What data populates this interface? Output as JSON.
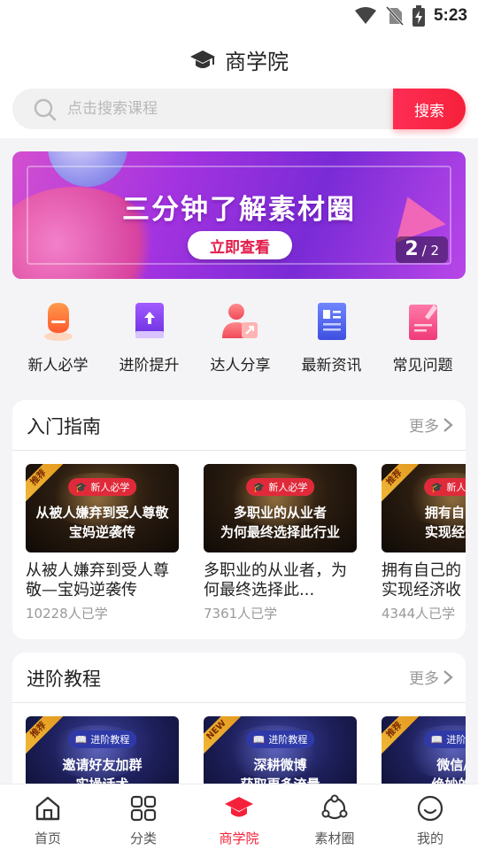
{
  "status_bar": {
    "time": "5:23"
  },
  "header": {
    "title": "商学院"
  },
  "search": {
    "placeholder": "点击搜索课程",
    "button_label": "搜索"
  },
  "banner": {
    "headline": "三分钟了解素材圈",
    "cta_label": "立即查看",
    "page_current": "2",
    "page_total": "/ 2"
  },
  "quick_links": [
    {
      "label": "新人必学",
      "icon": "newbie-icon"
    },
    {
      "label": "进阶提升",
      "icon": "upgrade-book-icon"
    },
    {
      "label": "达人分享",
      "icon": "share-icon"
    },
    {
      "label": "最新资讯",
      "icon": "news-icon"
    },
    {
      "label": "常见问题",
      "icon": "faq-icon"
    }
  ],
  "sections": [
    {
      "title": "入门指南",
      "more_label": "更多",
      "cards": [
        {
          "ribbon": "推荐",
          "tag": "新人必学",
          "thumb_text": "从被人嫌弃到受人尊敬\n宝妈逆袭传",
          "title": "从被人嫌弃到受人尊敬—宝妈逆袭传",
          "count": "10228人已学"
        },
        {
          "ribbon": "",
          "tag": "新人必学",
          "thumb_text": "多职业的从业者\n为何最终选择此行业",
          "title": "多职业的从业者，为何最终选择此...",
          "count": "7361人已学"
        },
        {
          "ribbon": "推荐",
          "tag": "新人必学",
          "thumb_text": "拥有自己的\n实现经济收",
          "title": "拥有自己的\n实现经济收",
          "count": "4344人已学"
        }
      ]
    },
    {
      "title": "进阶教程",
      "more_label": "更多",
      "cards": [
        {
          "ribbon": "推荐",
          "tag": "进阶教程",
          "thumb_text": "邀请好友加群\n实操话术",
          "title": "",
          "count": ""
        },
        {
          "ribbon": "NEW",
          "tag": "进阶教程",
          "thumb_text": "深耕微博\n获取更多流量",
          "title": "",
          "count": ""
        },
        {
          "ribbon": "推荐",
          "tag": "进阶教程",
          "thumb_text": "微信/Q\n绝妙的引",
          "title": "",
          "count": ""
        }
      ]
    }
  ],
  "tabs": [
    {
      "label": "首页",
      "icon": "home-icon",
      "active": false
    },
    {
      "label": "分类",
      "icon": "category-icon",
      "active": false
    },
    {
      "label": "商学院",
      "icon": "graduation-cap-icon",
      "active": true
    },
    {
      "label": "素材圈",
      "icon": "circle-network-icon",
      "active": false
    },
    {
      "label": "我的",
      "icon": "profile-smile-icon",
      "active": false
    }
  ],
  "colors": {
    "accent": "#f5213a",
    "banner_purple": "#a333e0",
    "icon_orange": "#ff6a3d",
    "icon_purple": "#7b3fe4",
    "icon_blue": "#4a5de8",
    "icon_pink": "#ff4f8a"
  }
}
